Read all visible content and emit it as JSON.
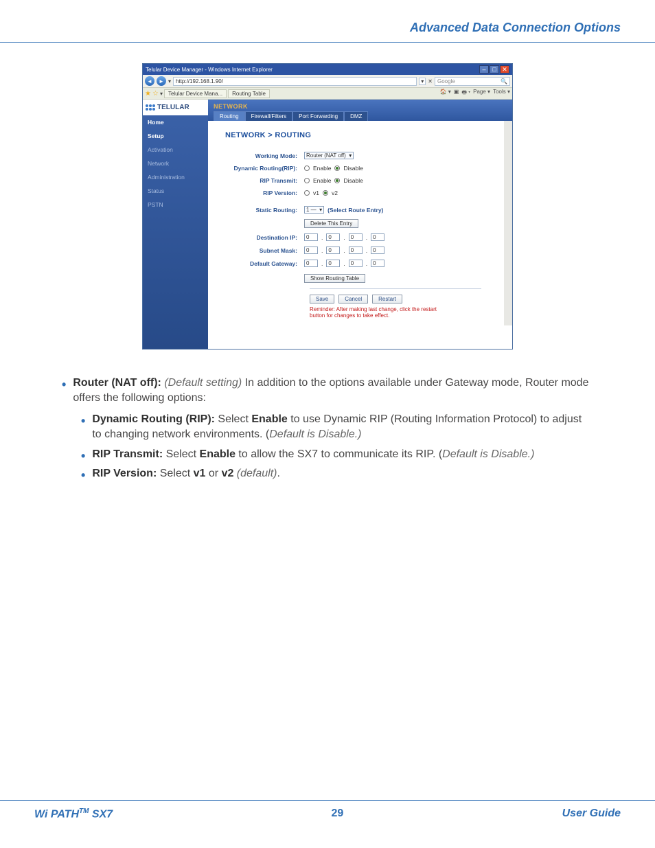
{
  "header": {
    "title": "Advanced Data Connection Options"
  },
  "footer": {
    "left_prefix": "Wi PATH",
    "left_suffix": " SX7",
    "page": "29",
    "right": "User Guide"
  },
  "ie": {
    "window_title": "Telular Device Manager - Windows Internet Explorer",
    "url": "http://192.168.1.90/",
    "search_placeholder": "Google",
    "tabs": [
      "Telular Device Mana...",
      "Routing Table"
    ],
    "tools": [
      "Page",
      "Tools"
    ]
  },
  "app": {
    "logo": "TELULAR",
    "side_items": [
      "Home",
      "Setup",
      "Activation",
      "Network",
      "Administration",
      "Status",
      "PSTN"
    ],
    "band_title": "NETWORK",
    "band_tabs": [
      "Routing",
      "Firewall/Filters",
      "Port Forwarding",
      "DMZ"
    ],
    "breadcrumb": "NETWORK > ROUTING",
    "labels": {
      "working_mode": "Working Mode:",
      "dyn_routing": "Dynamic Routing(RIP):",
      "rip_transmit": "RIP Transmit:",
      "rip_version": "RIP Version:",
      "static_routing": "Static Routing:",
      "dest_ip": "Destination IP:",
      "subnet": "Subnet Mask:",
      "gateway": "Default Gateway:"
    },
    "values": {
      "working_mode": "Router (NAT off)",
      "enable": "Enable",
      "disable": "Disable",
      "v1": "v1",
      "v2": "v2",
      "route_sel": "1 —",
      "route_hint": "(Select Route Entry)",
      "delete_entry": "Delete This Entry",
      "ip_octet": "0",
      "show_table": "Show Routing Table",
      "save": "Save",
      "cancel": "Cancel",
      "restart": "Restart",
      "reminder": "Reminder: After making last change, click the restart button for changes to take effect."
    }
  },
  "doc": {
    "p1_lead": "Router (NAT off):",
    "p1_ital": " (Default setting) ",
    "p1_rest": "In addition to the options available under Gateway mode, Router mode offers the following options:",
    "b1_lead": "Dynamic Routing (RIP):",
    "b1_mid1": " Select ",
    "b1_bold": "Enable",
    "b1_mid2": " to use Dynamic RIP (Routing Information Protocol) to adjust to changing network environments. (",
    "b1_ital": "Default is Disable.)",
    "b2_lead": "RIP Transmit:",
    "b2_mid1": " Select ",
    "b2_bold": "Enable",
    "b2_mid2": " to allow the SX7 to communicate its RIP. (",
    "b2_ital": "Default is Disable.)",
    "b3_lead": "RIP Version:",
    "b3_mid1": " Select ",
    "b3_b1": "v1",
    "b3_or": " or ",
    "b3_b2": "v2",
    "b3_ital": " (default)",
    "b3_dot": "."
  }
}
